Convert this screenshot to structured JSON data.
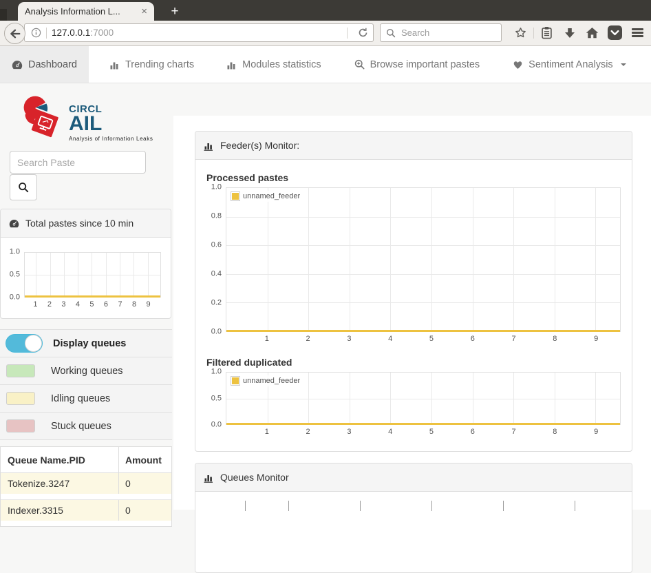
{
  "browser": {
    "tab_title": "Analysis Information L...",
    "tab_close_glyph": "×",
    "new_tab_glyph": "+",
    "url_host": "127.0.0.1",
    "url_port": ":7000",
    "search_placeholder": "Search",
    "toolbar_icons": [
      "back-icon",
      "info-icon",
      "reload-icon",
      "search-icon",
      "star-icon",
      "reading-list-icon",
      "download-icon",
      "home-icon",
      "pocket-icon",
      "menu-icon"
    ]
  },
  "nav": {
    "items": [
      {
        "label": "Dashboard",
        "icon": "tachometer-icon",
        "active": true
      },
      {
        "label": "Trending charts",
        "icon": "bar-chart-icon",
        "active": false
      },
      {
        "label": "Modules statistics",
        "icon": "bar-chart-icon",
        "active": false
      },
      {
        "label": "Browse important pastes",
        "icon": "search-plus-icon",
        "active": false
      },
      {
        "label": "Sentiment Analysis",
        "icon": "heart-icon",
        "active": false,
        "has_dropdown": true
      }
    ]
  },
  "sidebar": {
    "logo": {
      "brand": "CIRCL",
      "product": "AIL",
      "tagline": "Analysis of Information Leaks"
    },
    "search_placeholder": "Search Paste",
    "total_pastes_title": "Total pastes since 10 min",
    "display_queues_label": "Display queues",
    "display_queues_on": true,
    "queue_legend": [
      {
        "label": "Working queues",
        "color": "#c7e8ba"
      },
      {
        "label": "Idling queues",
        "color": "#f9f1c6"
      },
      {
        "label": "Stuck queues",
        "color": "#e7c3c3"
      }
    ],
    "queue_table": {
      "headers": [
        "Queue Name.PID",
        "Amount"
      ],
      "rows": [
        {
          "name": "Tokenize.3247",
          "amount": "0",
          "status": "idling"
        },
        {
          "name": "Indexer.3315",
          "amount": "0",
          "status": "idling"
        }
      ],
      "idling_row_color": "#fcf8e3"
    }
  },
  "main": {
    "feeder_panel_title": "Feeder(s) Monitor:",
    "queues_panel_title": "Queues Monitor"
  },
  "chart_data": [
    {
      "id": "total-pastes-10min",
      "type": "line",
      "title": "Total pastes since 10 min",
      "x_ticks": [
        "1",
        "2",
        "3",
        "4",
        "5",
        "6",
        "7",
        "8",
        "9"
      ],
      "xlim": [
        0.2,
        9.9
      ],
      "y_ticks": [
        "1.0",
        "0.5",
        "0.0"
      ],
      "ylim": [
        0,
        1
      ],
      "grid": true,
      "legend": null,
      "series": [
        {
          "name": "total pastes",
          "color": "#edc240",
          "values": [
            0,
            0,
            0,
            0,
            0,
            0,
            0,
            0,
            0
          ]
        }
      ]
    },
    {
      "id": "processed-pastes",
      "type": "line",
      "title": "Processed pastes",
      "x_ticks": [
        "1",
        "2",
        "3",
        "4",
        "5",
        "6",
        "7",
        "8",
        "9"
      ],
      "xlim": [
        0,
        9.6
      ],
      "y_ticks": [
        "1.0",
        "0.8",
        "0.6",
        "0.4",
        "0.2",
        "0.0"
      ],
      "ylim": [
        0,
        1
      ],
      "grid": true,
      "legend": "unnamed_feeder",
      "legend_color": "#edc240",
      "series": [
        {
          "name": "unnamed_feeder",
          "color": "#edc240",
          "values": [
            0,
            0,
            0,
            0,
            0,
            0,
            0,
            0,
            0
          ]
        }
      ]
    },
    {
      "id": "filtered-duplicated",
      "type": "line",
      "title": "Filtered duplicated",
      "x_ticks": [
        "1",
        "2",
        "3",
        "4",
        "5",
        "6",
        "7",
        "8",
        "9"
      ],
      "xlim": [
        0,
        9.6
      ],
      "y_ticks": [
        "1.0",
        "0.5",
        "0.0"
      ],
      "ylim": [
        0,
        1
      ],
      "grid": true,
      "legend": "unnamed_feeder",
      "legend_color": "#edc240",
      "series": [
        {
          "name": "unnamed_feeder",
          "color": "#edc240",
          "values": [
            0,
            0,
            0,
            0,
            0,
            0,
            0,
            0,
            0
          ]
        }
      ]
    },
    {
      "id": "queues-monitor",
      "type": "line",
      "title": "Queues Monitor",
      "note": "chart cropped by viewport bottom; only top axis tick marks visible",
      "tick_percents": [
        6.8,
        17.5,
        35.3,
        53.0,
        70.8,
        88.6
      ]
    }
  ]
}
